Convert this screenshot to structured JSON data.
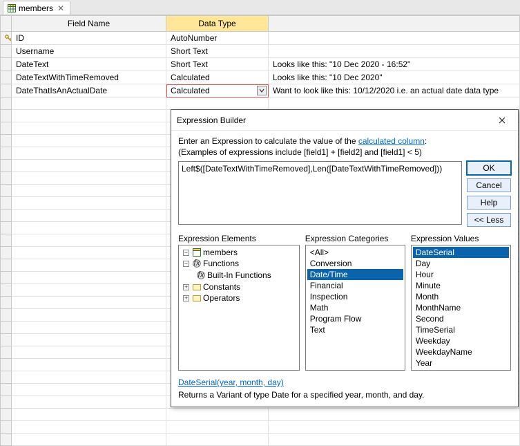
{
  "tab": {
    "label": "members",
    "close": "✕"
  },
  "columns": {
    "sel": "",
    "field": "Field Name",
    "type": "Data Type",
    "desc": ""
  },
  "rows": [
    {
      "key": true,
      "field": "ID",
      "type": "AutoNumber",
      "desc": ""
    },
    {
      "key": false,
      "field": "Username",
      "type": "Short Text",
      "desc": ""
    },
    {
      "key": false,
      "field": "DateText",
      "type": "Short Text",
      "desc": "Looks like this: \"10 Dec 2020 - 16:52\""
    },
    {
      "key": false,
      "field": "DateTextWithTimeRemoved",
      "type": "Calculated",
      "desc": "Looks like this: \"10 Dec 2020\""
    },
    {
      "key": false,
      "field": "DateThatIsAnActualDate",
      "type": "Calculated",
      "desc": "Want to look like this: 10/12/2020 i.e. an actual date data type",
      "selected": true
    }
  ],
  "blankRows": 28,
  "dialog": {
    "title": "Expression Builder",
    "prompt_pre": "Enter an Expression to calculate the value of the ",
    "prompt_link": "calculated column",
    "prompt_post": ":",
    "examples": "(Examples of expressions include [field1] + [field2] and [field1] < 5)",
    "expression": "Left$([DateTextWithTimeRemoved],Len([DateTextWithTimeRemoved]))",
    "buttons": {
      "ok": "OK",
      "cancel": "Cancel",
      "help": "Help",
      "less": "<< Less"
    },
    "labels": {
      "elements": "Expression Elements",
      "categories": "Expression Categories",
      "values": "Expression Values"
    },
    "tree": {
      "root": "members",
      "functions": "Functions",
      "builtin": "Built-In Functions",
      "constants": "Constants",
      "operators": "Operators"
    },
    "categories": [
      "<All>",
      "Conversion",
      "Date/Time",
      "Financial",
      "Inspection",
      "Math",
      "Program Flow",
      "Text"
    ],
    "categories_selected": "Date/Time",
    "values": [
      "DateSerial",
      "Day",
      "Hour",
      "Minute",
      "Month",
      "MonthName",
      "Second",
      "TimeSerial",
      "Weekday",
      "WeekdayName",
      "Year"
    ],
    "values_selected": "DateSerial",
    "signature": "DateSerial(year, month, day)",
    "sigdesc": "Returns a Variant of type Date for a specified year, month, and day."
  }
}
